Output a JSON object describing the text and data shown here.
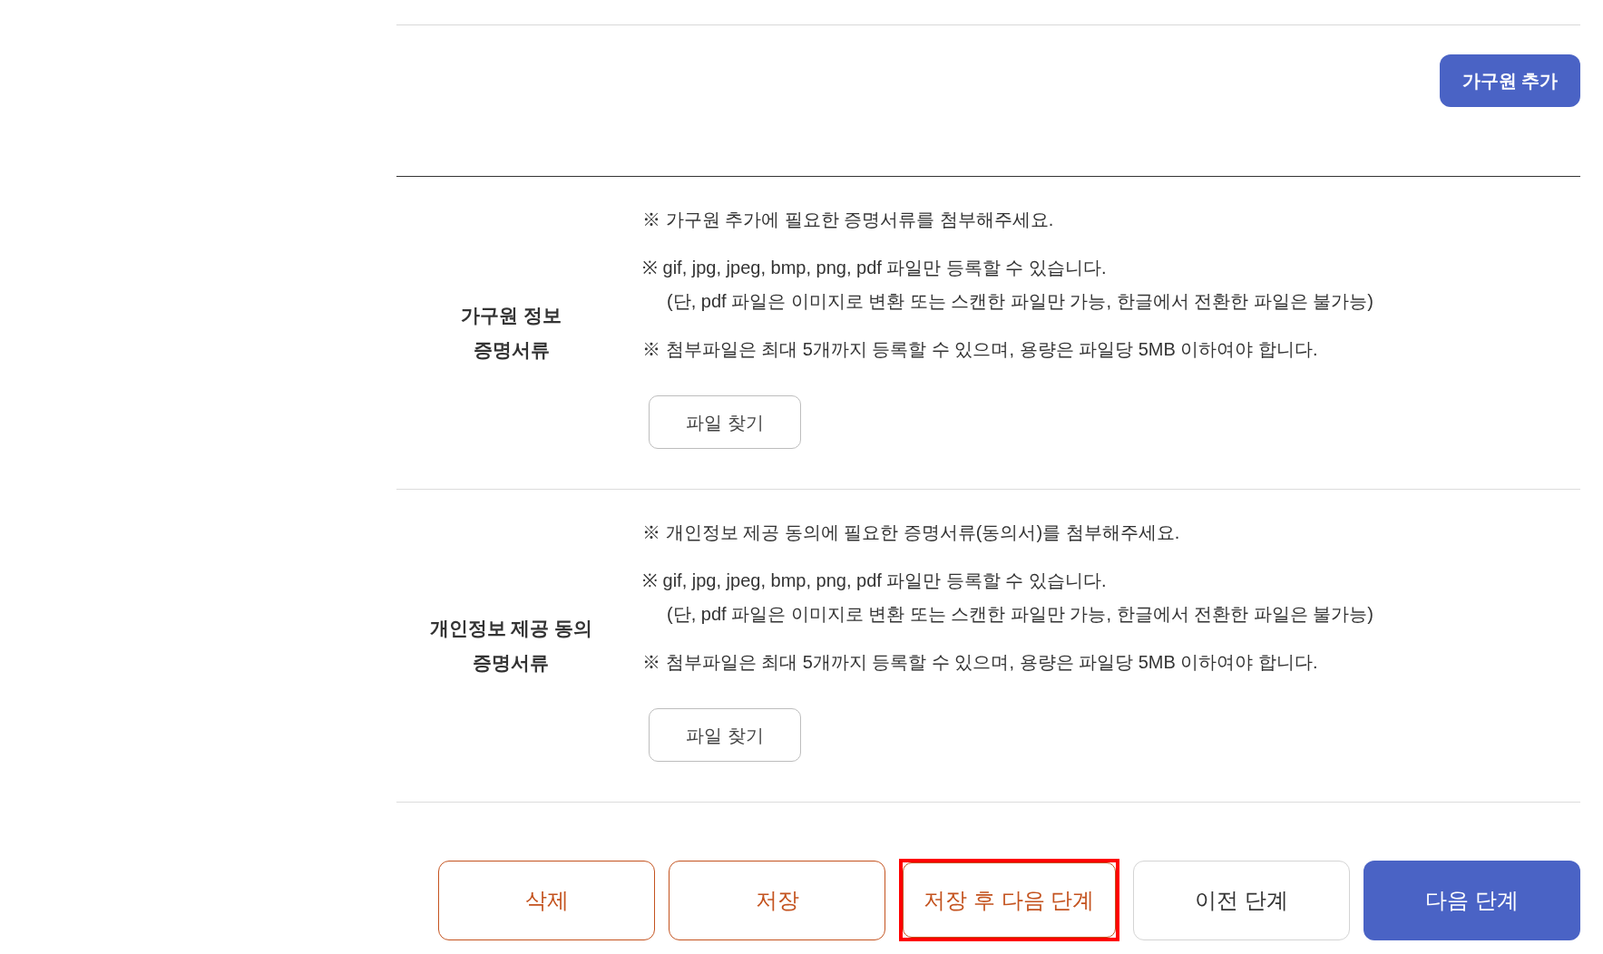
{
  "top_actions": {
    "add_member_button": "가구원 추가"
  },
  "sections": [
    {
      "label": [
        "가구원 정보",
        "증명서류"
      ],
      "notes": [
        {
          "text": "※ 가구원 추가에 필요한 증명서류를 첨부해주세요."
        },
        {
          "text": "※ gif, jpg, jpeg, bmp, png, pdf 파일만 등록할 수 있습니다.",
          "detail": "(단, pdf 파일은 이미지로 변환 또는 스캔한 파일만 가능, 한글에서 전환한 파일은 불가능)"
        },
        {
          "text": "※ 첨부파일은 최대 5개까지 등록할 수 있으며, 용량은 파일당 5MB 이하여야 합니다."
        }
      ],
      "file_button": "파일 찾기"
    },
    {
      "label": [
        "개인정보 제공 동의",
        "증명서류"
      ],
      "notes": [
        {
          "text": "※ 개인정보 제공 동의에 필요한 증명서류(동의서)를 첨부해주세요."
        },
        {
          "text": "※ gif, jpg, jpeg, bmp, png, pdf 파일만 등록할 수 있습니다.",
          "detail": "(단, pdf 파일은 이미지로 변환 또는 스캔한 파일만 가능, 한글에서 전환한 파일은 불가능)"
        },
        {
          "text": "※ 첨부파일은 최대 5개까지 등록할 수 있으며, 용량은 파일당 5MB 이하여야 합니다."
        }
      ],
      "file_button": "파일 찾기"
    }
  ],
  "footer_buttons": [
    {
      "label": "삭제",
      "kind": "accent",
      "highlighted": false
    },
    {
      "label": "저장",
      "kind": "accent",
      "highlighted": false
    },
    {
      "label": "저장 후 다음 단계",
      "kind": "accent",
      "highlighted": true
    },
    {
      "label": "이전 단계",
      "kind": "outline",
      "highlighted": false
    },
    {
      "label": "다음 단계",
      "kind": "primary",
      "highlighted": false
    }
  ]
}
